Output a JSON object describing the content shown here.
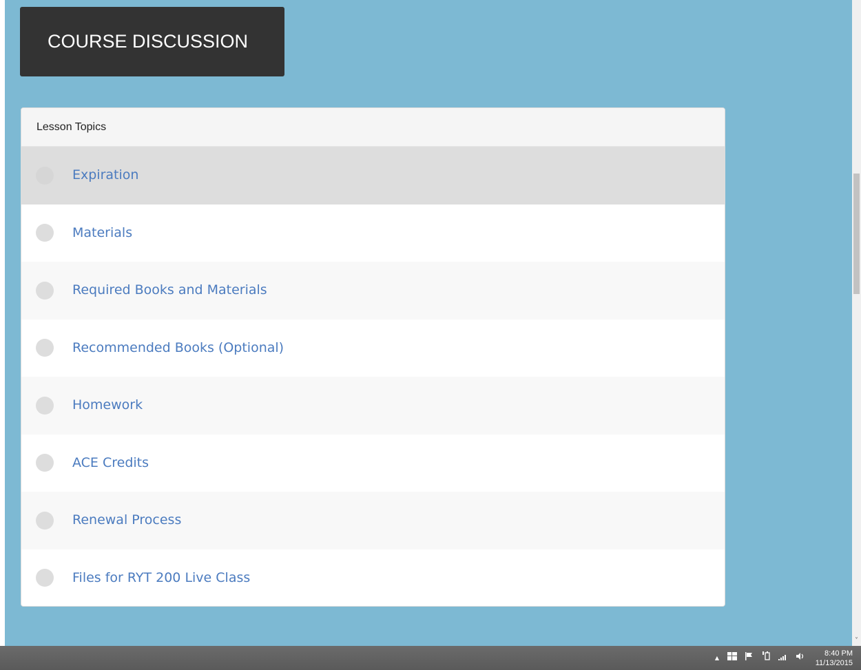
{
  "header": {
    "course_discussion_label": "COURSE DISCUSSION"
  },
  "lesson_topics": {
    "title": "Lesson Topics",
    "items": [
      {
        "label": "Expiration",
        "active": true
      },
      {
        "label": "Materials"
      },
      {
        "label": "Required Books and Materials"
      },
      {
        "label": "Recommended Books (Optional)"
      },
      {
        "label": "Homework"
      },
      {
        "label": "ACE Credits"
      },
      {
        "label": "Renewal Process"
      },
      {
        "label": "Files for RYT 200 Live Class"
      }
    ]
  },
  "scrollbar": {
    "down_arrow": "˅"
  },
  "taskbar": {
    "tray_icons": {
      "show_hidden": "▲",
      "windows_icon": "windows-icon",
      "flag": "flag-icon",
      "power": "power-icon",
      "network": "signal-icon",
      "volume": "speaker-icon"
    },
    "clock_time": "8:40 PM",
    "clock_date": "11/13/2015"
  },
  "colors": {
    "background": "#7db9d3",
    "button_dark": "#333333",
    "link_blue": "#4b7bbf",
    "active_row": "#dddddd",
    "taskbar": "#5f5f5f"
  }
}
